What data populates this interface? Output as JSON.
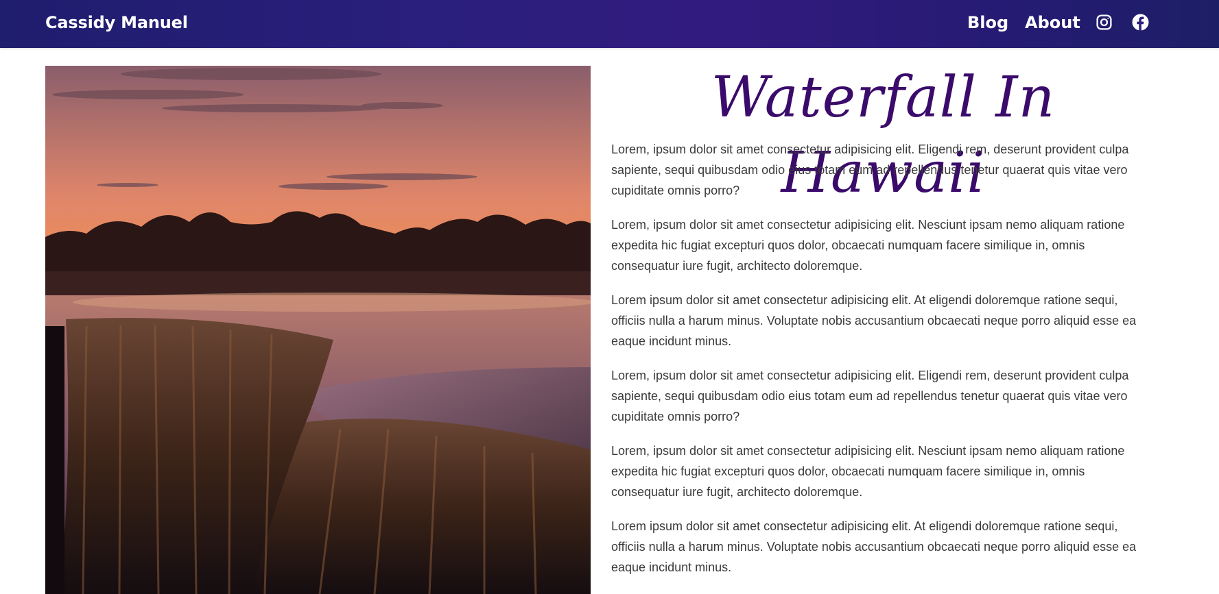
{
  "nav": {
    "brand": "Cassidy Manuel",
    "links": [
      {
        "label": "Blog"
      },
      {
        "label": "About"
      }
    ],
    "icons": [
      "instagram-icon",
      "facebook-icon"
    ],
    "colors": {
      "bar_start": "#1f1d6e",
      "bar_mid": "#321b7e",
      "text": "#ffffff"
    }
  },
  "article": {
    "title": "Waterfall In Hawaii",
    "title_color": "#3b0b6b",
    "paragraphs": [
      "Lorem, ipsum dolor sit amet consectetur adipisicing elit. Eligendi rem, deserunt provident culpa sapiente, sequi quibusdam odio eius totam eum ad repellendus tenetur quaerat quis vitae vero cupiditate omnis porro?",
      "Lorem, ipsum dolor sit amet consectetur adipisicing elit. Nesciunt ipsam nemo aliquam ratione expedita hic fugiat excepturi quos dolor, obcaecati numquam facere similique in, omnis consequatur iure fugit, architecto doloremque.",
      "Lorem ipsum dolor sit amet consectetur adipisicing elit. At eligendi doloremque ratione sequi, officiis nulla a harum minus. Voluptate nobis accusantium obcaecati neque porro aliquid esse ea eaque incidunt minus.",
      "Lorem, ipsum dolor sit amet consectetur adipisicing elit. Eligendi rem, deserunt provident culpa sapiente, sequi quibusdam odio eius totam eum ad repellendus tenetur quaerat quis vitae vero cupiditate omnis porro?",
      "Lorem, ipsum dolor sit amet consectetur adipisicing elit. Nesciunt ipsam nemo aliquam ratione expedita hic fugiat excepturi quos dolor, obcaecati numquam facere similique in, omnis consequatur iure fugit, architecto doloremque.",
      "Lorem ipsum dolor sit amet consectetur adipisicing elit. At eligendi doloremque ratione sequi, officiis nulla a harum minus. Voluptate nobis accusantium obcaecati neque porro aliquid esse ea eaque incidunt minus."
    ]
  }
}
